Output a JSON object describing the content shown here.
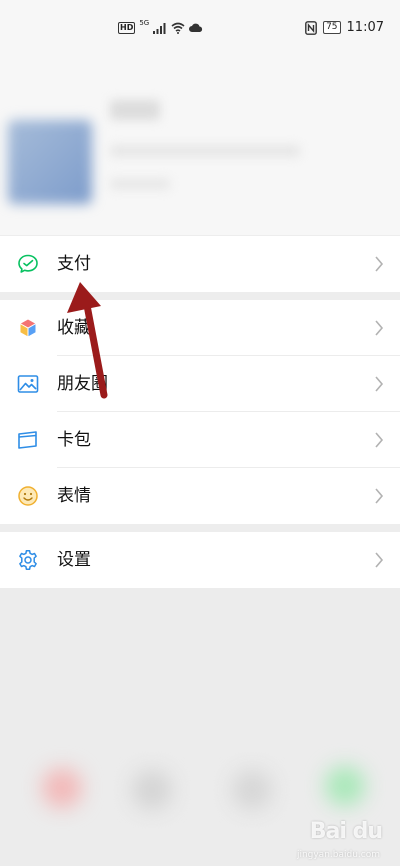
{
  "status_bar": {
    "hd": "HD",
    "network": "5G",
    "battery": "75",
    "time": "11:07"
  },
  "menu": {
    "payment": "支付",
    "favorites": "收藏",
    "moments": "朋友圈",
    "cards": "卡包",
    "stickers": "表情",
    "settings": "设置"
  },
  "watermark": {
    "brand": "Bai du",
    "sub": "jingyan.baidu.com"
  },
  "colors": {
    "accent_green": "#07c160",
    "arrow": "#9b1b1b"
  }
}
